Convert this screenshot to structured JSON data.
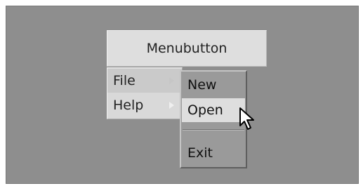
{
  "menubutton": {
    "label": "Menubutton"
  },
  "menu": {
    "items": [
      {
        "label": "File",
        "has_submenu": true,
        "active": true
      },
      {
        "label": "Help",
        "has_submenu": true,
        "active": false
      }
    ]
  },
  "submenu": {
    "items": [
      {
        "label": "New"
      },
      {
        "label": "Open",
        "highlighted": true
      },
      {
        "label": "Exit"
      }
    ]
  },
  "icons": {
    "cursor": "mouse-pointer-icon",
    "submenu_indicator": "chevron-right-icon"
  }
}
